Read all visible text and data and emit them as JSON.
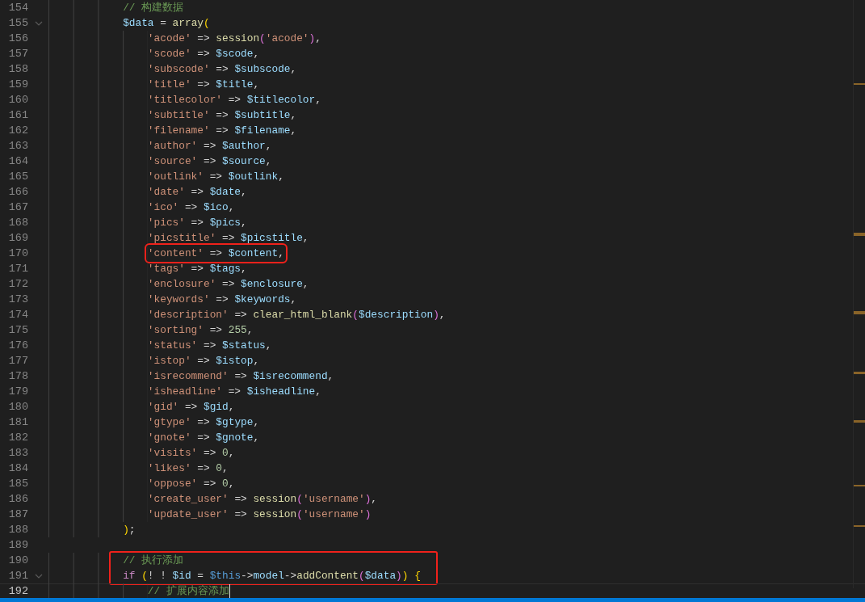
{
  "editor": {
    "blocks": [
      {
        "boxed": false,
        "lines": [
          {
            "number": "154",
            "tokens": [
              {
                "kind": "comment",
                "text": "            // 构建数据"
              }
            ]
          },
          {
            "number": "155",
            "foldable": true,
            "tokens": [
              {
                "kind": "var",
                "text": "            $data"
              },
              {
                "kind": "op",
                "text": " = "
              },
              {
                "kind": "fn",
                "text": "array"
              },
              {
                "kind": "bracket1",
                "text": "("
              }
            ]
          },
          {
            "number": "156",
            "tokens": [
              {
                "kind": "str",
                "text": "                'acode'"
              },
              {
                "kind": "op",
                "text": " => "
              },
              {
                "kind": "fn",
                "text": "session"
              },
              {
                "kind": "bracket2",
                "text": "("
              },
              {
                "kind": "str",
                "text": "'acode'"
              },
              {
                "kind": "bracket2",
                "text": ")"
              },
              {
                "kind": "op",
                "text": ","
              }
            ]
          },
          {
            "number": "157",
            "tokens": [
              {
                "kind": "str",
                "text": "                'scode'"
              },
              {
                "kind": "op",
                "text": " => "
              },
              {
                "kind": "var",
                "text": "$scode"
              },
              {
                "kind": "op",
                "text": ","
              }
            ]
          },
          {
            "number": "158",
            "tokens": [
              {
                "kind": "str",
                "text": "                'subscode'"
              },
              {
                "kind": "op",
                "text": " => "
              },
              {
                "kind": "var",
                "text": "$subscode"
              },
              {
                "kind": "op",
                "text": ","
              }
            ]
          },
          {
            "number": "159",
            "tokens": [
              {
                "kind": "str",
                "text": "                'title'"
              },
              {
                "kind": "op",
                "text": " => "
              },
              {
                "kind": "var",
                "text": "$title"
              },
              {
                "kind": "op",
                "text": ","
              }
            ]
          },
          {
            "number": "160",
            "tokens": [
              {
                "kind": "str",
                "text": "                'titlecolor'"
              },
              {
                "kind": "op",
                "text": " => "
              },
              {
                "kind": "var",
                "text": "$titlecolor"
              },
              {
                "kind": "op",
                "text": ","
              }
            ]
          },
          {
            "number": "161",
            "tokens": [
              {
                "kind": "str",
                "text": "                'subtitle'"
              },
              {
                "kind": "op",
                "text": " => "
              },
              {
                "kind": "var",
                "text": "$subtitle"
              },
              {
                "kind": "op",
                "text": ","
              }
            ]
          },
          {
            "number": "162",
            "tokens": [
              {
                "kind": "str",
                "text": "                'filename'"
              },
              {
                "kind": "op",
                "text": " => "
              },
              {
                "kind": "var",
                "text": "$filename"
              },
              {
                "kind": "op",
                "text": ","
              }
            ]
          },
          {
            "number": "163",
            "tokens": [
              {
                "kind": "str",
                "text": "                'author'"
              },
              {
                "kind": "op",
                "text": " => "
              },
              {
                "kind": "var",
                "text": "$author"
              },
              {
                "kind": "op",
                "text": ","
              }
            ]
          },
          {
            "number": "164",
            "tokens": [
              {
                "kind": "str",
                "text": "                'source'"
              },
              {
                "kind": "op",
                "text": " => "
              },
              {
                "kind": "var",
                "text": "$source"
              },
              {
                "kind": "op",
                "text": ","
              }
            ]
          },
          {
            "number": "165",
            "tokens": [
              {
                "kind": "str",
                "text": "                'outlink'"
              },
              {
                "kind": "op",
                "text": " => "
              },
              {
                "kind": "var",
                "text": "$outlink"
              },
              {
                "kind": "op",
                "text": ","
              }
            ]
          },
          {
            "number": "166",
            "tokens": [
              {
                "kind": "str",
                "text": "                'date'"
              },
              {
                "kind": "op",
                "text": " => "
              },
              {
                "kind": "var",
                "text": "$date"
              },
              {
                "kind": "op",
                "text": ","
              }
            ]
          },
          {
            "number": "167",
            "tokens": [
              {
                "kind": "str",
                "text": "                'ico'"
              },
              {
                "kind": "op",
                "text": " => "
              },
              {
                "kind": "var",
                "text": "$ico"
              },
              {
                "kind": "op",
                "text": ","
              }
            ]
          },
          {
            "number": "168",
            "tokens": [
              {
                "kind": "str",
                "text": "                'pics'"
              },
              {
                "kind": "op",
                "text": " => "
              },
              {
                "kind": "var",
                "text": "$pics"
              },
              {
                "kind": "op",
                "text": ","
              }
            ]
          },
          {
            "number": "169",
            "tokens": [
              {
                "kind": "str",
                "text": "                'picstitle'"
              },
              {
                "kind": "op",
                "text": " => "
              },
              {
                "kind": "var",
                "text": "$picstitle"
              },
              {
                "kind": "op",
                "text": ","
              }
            ]
          },
          {
            "number": "170",
            "boxed": true,
            "tokens": [
              {
                "kind": "str",
                "text": "                'content'"
              },
              {
                "kind": "op",
                "text": " => "
              },
              {
                "kind": "var",
                "text": "$content"
              },
              {
                "kind": "op",
                "text": ","
              }
            ]
          },
          {
            "number": "171",
            "tokens": [
              {
                "kind": "str",
                "text": "                'tags'"
              },
              {
                "kind": "op",
                "text": " => "
              },
              {
                "kind": "var",
                "text": "$tags"
              },
              {
                "kind": "op",
                "text": ","
              }
            ]
          },
          {
            "number": "172",
            "tokens": [
              {
                "kind": "str",
                "text": "                'enclosure'"
              },
              {
                "kind": "op",
                "text": " => "
              },
              {
                "kind": "var",
                "text": "$enclosure"
              },
              {
                "kind": "op",
                "text": ","
              }
            ]
          },
          {
            "number": "173",
            "tokens": [
              {
                "kind": "str",
                "text": "                'keywords'"
              },
              {
                "kind": "op",
                "text": " => "
              },
              {
                "kind": "var",
                "text": "$keywords"
              },
              {
                "kind": "op",
                "text": ","
              }
            ]
          },
          {
            "number": "174",
            "tokens": [
              {
                "kind": "str",
                "text": "                'description'"
              },
              {
                "kind": "op",
                "text": " => "
              },
              {
                "kind": "fn",
                "text": "clear_html_blank"
              },
              {
                "kind": "bracket2",
                "text": "("
              },
              {
                "kind": "var",
                "text": "$description"
              },
              {
                "kind": "bracket2",
                "text": ")"
              },
              {
                "kind": "op",
                "text": ","
              }
            ]
          },
          {
            "number": "175",
            "tokens": [
              {
                "kind": "str",
                "text": "                'sorting'"
              },
              {
                "kind": "op",
                "text": " => "
              },
              {
                "kind": "num",
                "text": "255"
              },
              {
                "kind": "op",
                "text": ","
              }
            ]
          },
          {
            "number": "176",
            "tokens": [
              {
                "kind": "str",
                "text": "                'status'"
              },
              {
                "kind": "op",
                "text": " => "
              },
              {
                "kind": "var",
                "text": "$status"
              },
              {
                "kind": "op",
                "text": ","
              }
            ]
          },
          {
            "number": "177",
            "tokens": [
              {
                "kind": "str",
                "text": "                'istop'"
              },
              {
                "kind": "op",
                "text": " => "
              },
              {
                "kind": "var",
                "text": "$istop"
              },
              {
                "kind": "op",
                "text": ","
              }
            ]
          },
          {
            "number": "178",
            "tokens": [
              {
                "kind": "str",
                "text": "                'isrecommend'"
              },
              {
                "kind": "op",
                "text": " => "
              },
              {
                "kind": "var",
                "text": "$isrecommend"
              },
              {
                "kind": "op",
                "text": ","
              }
            ]
          },
          {
            "number": "179",
            "tokens": [
              {
                "kind": "str",
                "text": "                'isheadline'"
              },
              {
                "kind": "op",
                "text": " => "
              },
              {
                "kind": "var",
                "text": "$isheadline"
              },
              {
                "kind": "op",
                "text": ","
              }
            ]
          },
          {
            "number": "180",
            "tokens": [
              {
                "kind": "str",
                "text": "                'gid'"
              },
              {
                "kind": "op",
                "text": " => "
              },
              {
                "kind": "var",
                "text": "$gid"
              },
              {
                "kind": "op",
                "text": ","
              }
            ]
          },
          {
            "number": "181",
            "tokens": [
              {
                "kind": "str",
                "text": "                'gtype'"
              },
              {
                "kind": "op",
                "text": " => "
              },
              {
                "kind": "var",
                "text": "$gtype"
              },
              {
                "kind": "op",
                "text": ","
              }
            ]
          },
          {
            "number": "182",
            "tokens": [
              {
                "kind": "str",
                "text": "                'gnote'"
              },
              {
                "kind": "op",
                "text": " => "
              },
              {
                "kind": "var",
                "text": "$gnote"
              },
              {
                "kind": "op",
                "text": ","
              }
            ]
          },
          {
            "number": "183",
            "tokens": [
              {
                "kind": "str",
                "text": "                'visits'"
              },
              {
                "kind": "op",
                "text": " => "
              },
              {
                "kind": "num",
                "text": "0"
              },
              {
                "kind": "op",
                "text": ","
              }
            ]
          },
          {
            "number": "184",
            "tokens": [
              {
                "kind": "str",
                "text": "                'likes'"
              },
              {
                "kind": "op",
                "text": " => "
              },
              {
                "kind": "num",
                "text": "0"
              },
              {
                "kind": "op",
                "text": ","
              }
            ]
          },
          {
            "number": "185",
            "tokens": [
              {
                "kind": "str",
                "text": "                'oppose'"
              },
              {
                "kind": "op",
                "text": " => "
              },
              {
                "kind": "num",
                "text": "0"
              },
              {
                "kind": "op",
                "text": ","
              }
            ]
          },
          {
            "number": "186",
            "tokens": [
              {
                "kind": "str",
                "text": "                'create_user'"
              },
              {
                "kind": "op",
                "text": " => "
              },
              {
                "kind": "fn",
                "text": "session"
              },
              {
                "kind": "bracket2",
                "text": "("
              },
              {
                "kind": "str",
                "text": "'username'"
              },
              {
                "kind": "bracket2",
                "text": ")"
              },
              {
                "kind": "op",
                "text": ","
              }
            ]
          },
          {
            "number": "187",
            "tokens": [
              {
                "kind": "str",
                "text": "                'update_user'"
              },
              {
                "kind": "op",
                "text": " => "
              },
              {
                "kind": "fn",
                "text": "session"
              },
              {
                "kind": "bracket2",
                "text": "("
              },
              {
                "kind": "str",
                "text": "'username'"
              },
              {
                "kind": "bracket2",
                "text": ")"
              }
            ]
          },
          {
            "number": "188",
            "tokens": [
              {
                "kind": "bracket1",
                "text": "            )"
              },
              {
                "kind": "op",
                "text": ";"
              }
            ]
          },
          {
            "number": "189"
          }
        ]
      },
      {
        "boxed": true,
        "lines": [
          {
            "number": "190",
            "tokens": [
              {
                "kind": "comment",
                "text": "            // 执行添加"
              }
            ]
          },
          {
            "number": "191",
            "foldable": true,
            "tokens": [
              {
                "kind": "keyword",
                "text": "            if"
              },
              {
                "kind": "bracket1",
                "text": " ("
              },
              {
                "kind": "op",
                "text": "! ! "
              },
              {
                "kind": "var",
                "text": "$id"
              },
              {
                "kind": "op",
                "text": " = "
              },
              {
                "kind": "this",
                "text": "$this"
              },
              {
                "kind": "op",
                "text": "->"
              },
              {
                "kind": "var",
                "text": "model"
              },
              {
                "kind": "op",
                "text": "->"
              },
              {
                "kind": "fn",
                "text": "addContent"
              },
              {
                "kind": "bracket2",
                "text": "("
              },
              {
                "kind": "var",
                "text": "$data"
              },
              {
                "kind": "bracket2",
                "text": ")"
              },
              {
                "kind": "bracket1",
                "text": ") {"
              }
            ]
          }
        ]
      },
      {
        "boxed": false,
        "lines": [
          {
            "number": "192",
            "current": true,
            "tokens": [
              {
                "kind": "comment",
                "text": "                // 扩展内容添加"
              }
            ]
          }
        ]
      }
    ]
  }
}
